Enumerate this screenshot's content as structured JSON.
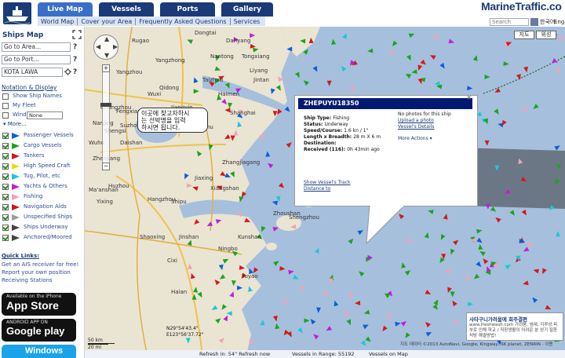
{
  "header": {
    "tabs": [
      {
        "label": "Live Map",
        "active": true
      },
      {
        "label": "Vessels",
        "active": false
      },
      {
        "label": "Ports",
        "active": false
      },
      {
        "label": "Gallery",
        "active": false
      }
    ],
    "subnav": [
      "World Map",
      "Cover your Area",
      "Frequently Asked Questions",
      "Services"
    ],
    "brand": "MarineTraffic.co",
    "search_placeholder": "Search",
    "lang_links": [
      "한국어",
      "Eng"
    ],
    "map_type_buttons": [
      "지도",
      "위성"
    ]
  },
  "sidebar": {
    "title": "Ships Map",
    "go_to_area": "Go to Area...",
    "go_to_port": "Go to Port...",
    "vessel_input": "KOTA LAWA",
    "notation_link": "Notation & Display",
    "show_ship_names": "Show Ship Names",
    "my_fleet": "My Fleet",
    "wind": "Wind",
    "wind_option": "None",
    "more": "More...",
    "legend": [
      {
        "label": "Passenger Vessels",
        "color": "#0a5fd8"
      },
      {
        "label": "Cargo Vessels",
        "color": "#1da31d"
      },
      {
        "label": "Tankers",
        "color": "#d21a1a"
      },
      {
        "label": "High Speed Craft",
        "color": "#e8d81a"
      },
      {
        "label": "Tug, Pilot, etc",
        "color": "#1bc7d6"
      },
      {
        "label": "Yachts & Others",
        "color": "#c21ed6"
      },
      {
        "label": "Fishing",
        "color": "#f2a3b3"
      },
      {
        "label": "Navigation Aids",
        "color": "#d11"
      },
      {
        "label": "Unspecified Ships",
        "color": "#9a9a9a"
      },
      {
        "label": "Ships Underway",
        "color": "#444"
      },
      {
        "label": "Anchored/Moored",
        "color": "#444"
      }
    ],
    "quick_links_title": "Quick Links:",
    "quick_links": [
      "Get an AIS receiver for free!",
      "Report your own position",
      "Receiving Stations"
    ],
    "appstore_small": "Available on the iPhone",
    "appstore_big": "App Store",
    "android_small": "ANDROID APP ON",
    "android_big": "Google play",
    "windows_big": "Windows"
  },
  "map": {
    "callout_text": [
      "이곳에 찾고자하시",
      "는 선박명을 입력",
      "하시면 됩니다."
    ],
    "popup": {
      "title": "ZHEPUYU18350",
      "rows": [
        {
          "label": "Ship Type:",
          "value": "Fishing"
        },
        {
          "label": "Status:",
          "value": "Underway"
        },
        {
          "label": "Speed/Course:",
          "value": "1.6 kn / 1°"
        },
        {
          "label": "Length x Breadth:",
          "value": "28 m X 6 m"
        },
        {
          "label": "Destination:",
          "value": ""
        },
        {
          "label": "Received (116):",
          "value": "0h 43min ago"
        }
      ],
      "no_photos": "No photos for this ship",
      "upload_photo": "Upload a photo",
      "vessel_details": "Vessel's Details",
      "more_actions": "More Actions",
      "show_track": "Show Vessel's Track",
      "distance_to": "Distance to"
    },
    "status_refresh": "Refresh in: 54\" Refresh now",
    "status_vessels": "Vessels in Range: 55192",
    "status_vessels_suffix": "Vessels on Map",
    "copyright": "지도 데이터 ©2013 AutoNavi, Google, Kingway, SK planet, ZENRIN - 이용",
    "ad_title": "사타구니가려움에 회주결편",
    "ad_body": "www.freshwash.com  가려움, 냄새, 지루성 피부로 인해 학교 / 직장생활이 어려운 분 성기 질환 처방 해결방법!",
    "scale_km": "50 km",
    "scale_mi": "20 mi",
    "coord_1": "N29°54'43.4\"",
    "coord_2": "E123°56'37.72\"",
    "place_labels": [
      "Nanjing",
      "Wuxi",
      "Suzhou",
      "Shanghai",
      "Hangzhou",
      "Jiaxing",
      "Shaoxing",
      "Ningbo",
      "Zhoushan",
      "Changzhou",
      "Zhenjiang",
      "Yangzhou",
      "Taizhou",
      "Nantong",
      "Huzhou",
      "Yixing",
      "Wuhu",
      "Ma'anshan",
      "Haimen",
      "Qidong",
      "Jiangyin",
      "Zhangjiagang",
      "Kunshan",
      "Jinshan",
      "Cixi",
      "Yuyao",
      "Shengzhou",
      "Xinchang",
      "Xiangshan",
      "Shipu",
      "Daishan",
      "Shengsi",
      "Fengxian",
      "Pinghu",
      "Tongxiang",
      "Liyang",
      "Jintan",
      "Danyang",
      "Yangzhong",
      "Dongtai",
      "Rugao",
      "Haian"
    ]
  }
}
